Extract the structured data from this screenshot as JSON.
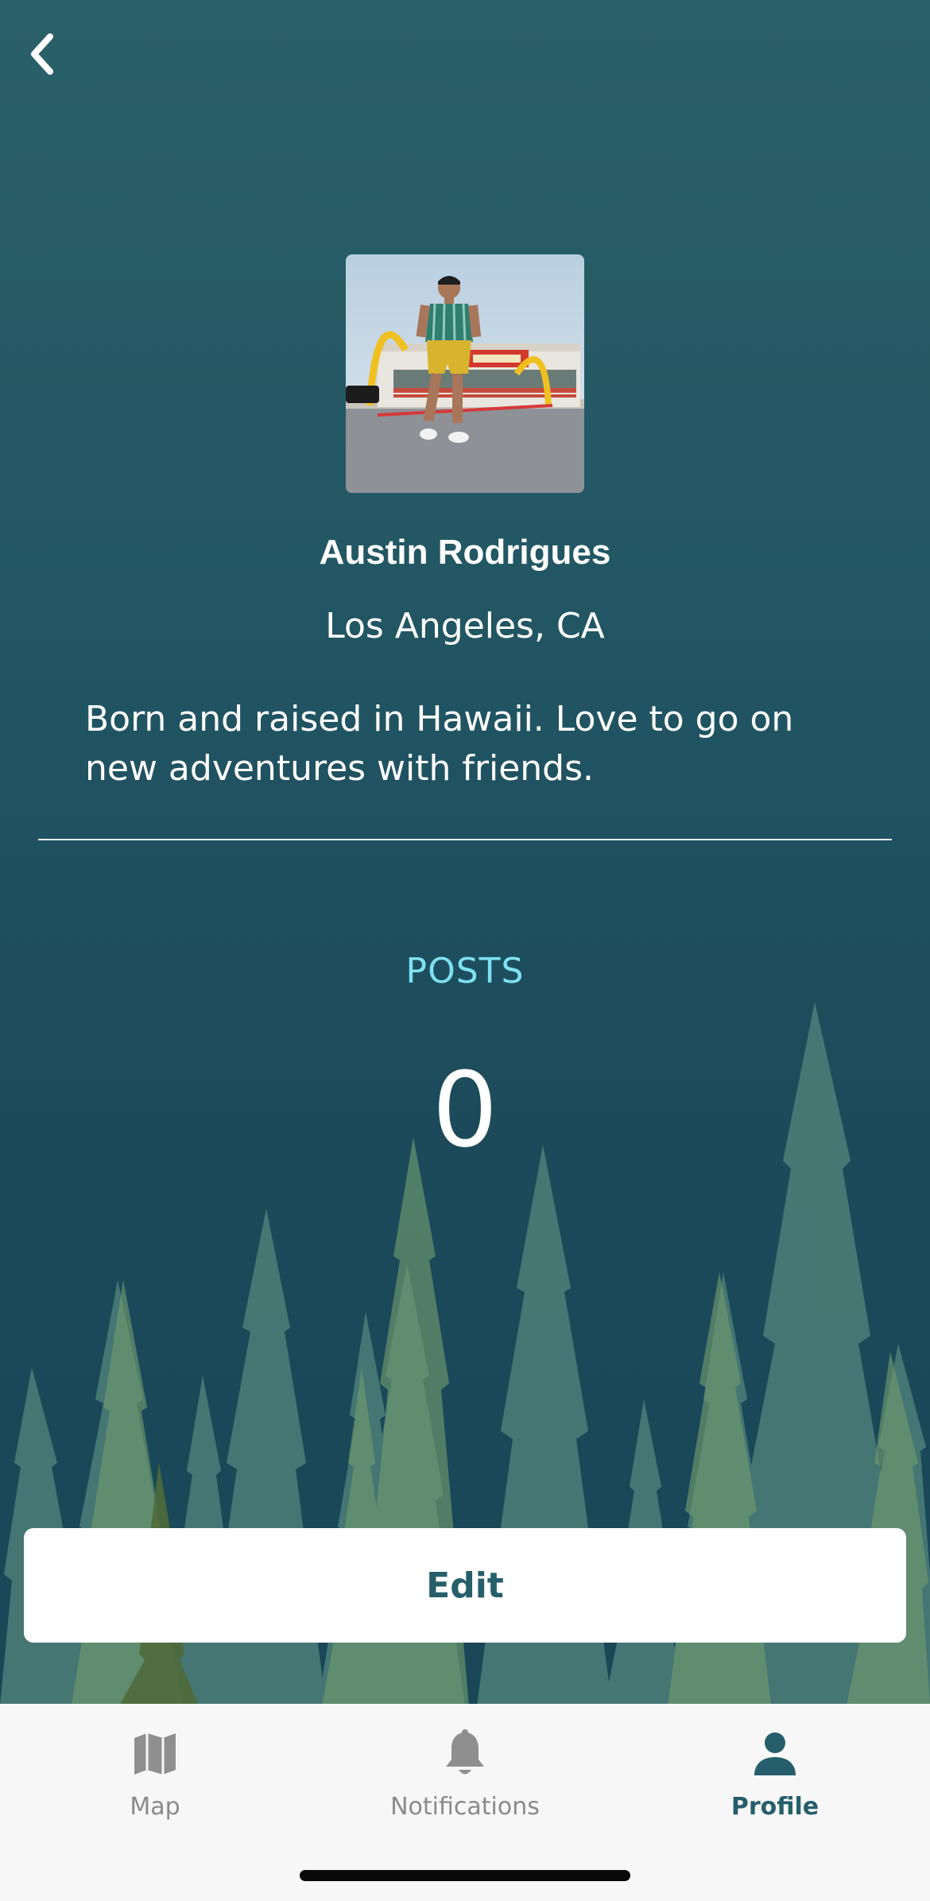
{
  "header": {
    "back_icon": "chevron-left-icon"
  },
  "profile": {
    "name": "Austin Rodrigues",
    "location": "Los Angeles, CA",
    "bio": "Born and raised in Hawaii. Love to go on new adventures with friends."
  },
  "stats": {
    "posts_label": "POSTS",
    "posts_count": "0"
  },
  "actions": {
    "edit_label": "Edit"
  },
  "tabbar": {
    "tabs": [
      {
        "label": "Map",
        "icon": "map-icon",
        "active": false
      },
      {
        "label": "Notifications",
        "icon": "bell-icon",
        "active": false
      },
      {
        "label": "Profile",
        "icon": "person-icon",
        "active": true
      }
    ]
  },
  "colors": {
    "background": "#215563",
    "accent": "#265f6b",
    "posts_label": "#7fe0f0",
    "tab_inactive": "#8a8a8a",
    "tab_bar": "#f7f7f7"
  }
}
